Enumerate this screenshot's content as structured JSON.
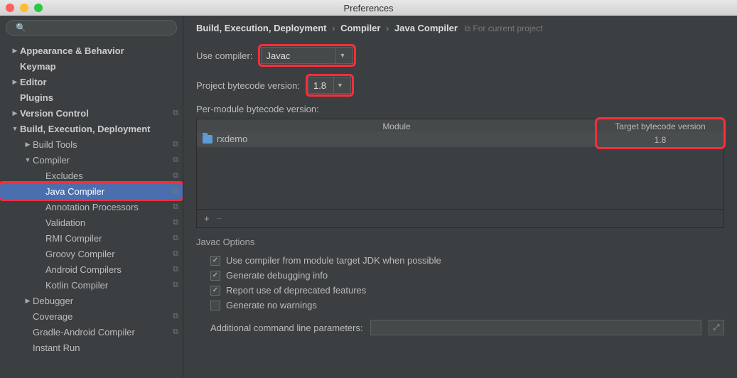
{
  "window": {
    "title": "Preferences"
  },
  "search": {
    "placeholder": ""
  },
  "tree": [
    {
      "label": "Appearance & Behavior",
      "depth": 0,
      "arrow": "▶",
      "bold": true
    },
    {
      "label": "Keymap",
      "depth": 0,
      "arrow": "",
      "bold": true
    },
    {
      "label": "Editor",
      "depth": 0,
      "arrow": "▶",
      "bold": true
    },
    {
      "label": "Plugins",
      "depth": 0,
      "arrow": "",
      "bold": true
    },
    {
      "label": "Version Control",
      "depth": 0,
      "arrow": "▶",
      "bold": true,
      "copy": true
    },
    {
      "label": "Build, Execution, Deployment",
      "depth": 0,
      "arrow": "▼",
      "bold": true
    },
    {
      "label": "Build Tools",
      "depth": 1,
      "arrow": "▶",
      "copy": true
    },
    {
      "label": "Compiler",
      "depth": 1,
      "arrow": "▼",
      "copy": true
    },
    {
      "label": "Excludes",
      "depth": 2,
      "copy": true
    },
    {
      "label": "Java Compiler",
      "depth": 2,
      "copy": true,
      "selected": true,
      "highlight": true
    },
    {
      "label": "Annotation Processors",
      "depth": 2,
      "copy": true
    },
    {
      "label": "Validation",
      "depth": 2,
      "copy": true
    },
    {
      "label": "RMI Compiler",
      "depth": 2,
      "copy": true
    },
    {
      "label": "Groovy Compiler",
      "depth": 2,
      "copy": true
    },
    {
      "label": "Android Compilers",
      "depth": 2,
      "copy": true
    },
    {
      "label": "Kotlin Compiler",
      "depth": 2,
      "copy": true
    },
    {
      "label": "Debugger",
      "depth": 1,
      "arrow": "▶"
    },
    {
      "label": "Coverage",
      "depth": 1,
      "copy": true
    },
    {
      "label": "Gradle-Android Compiler",
      "depth": 1,
      "copy": true
    },
    {
      "label": "Instant Run",
      "depth": 1
    }
  ],
  "breadcrumb": {
    "parts": [
      "Build, Execution, Deployment",
      "Compiler",
      "Java Compiler"
    ],
    "project_hint": "For current project"
  },
  "fields": {
    "use_compiler_label": "Use compiler:",
    "use_compiler_value": "Javac",
    "bytecode_label": "Project bytecode version:",
    "bytecode_value": "1.8",
    "per_module_label": "Per-module bytecode version:"
  },
  "table": {
    "col1": "Module",
    "col2": "Target bytecode version",
    "rows": [
      {
        "name": "rxdemo",
        "version": "1.8"
      }
    ],
    "add": "+",
    "remove": "−"
  },
  "javac": {
    "title": "Javac Options",
    "opts": [
      {
        "label": "Use compiler from module target JDK when possible",
        "checked": true
      },
      {
        "label": "Generate debugging info",
        "checked": true
      },
      {
        "label": "Report use of deprecated features",
        "checked": true
      },
      {
        "label": "Generate no warnings",
        "checked": false
      }
    ],
    "params_label": "Additional command line parameters:",
    "params_value": ""
  }
}
